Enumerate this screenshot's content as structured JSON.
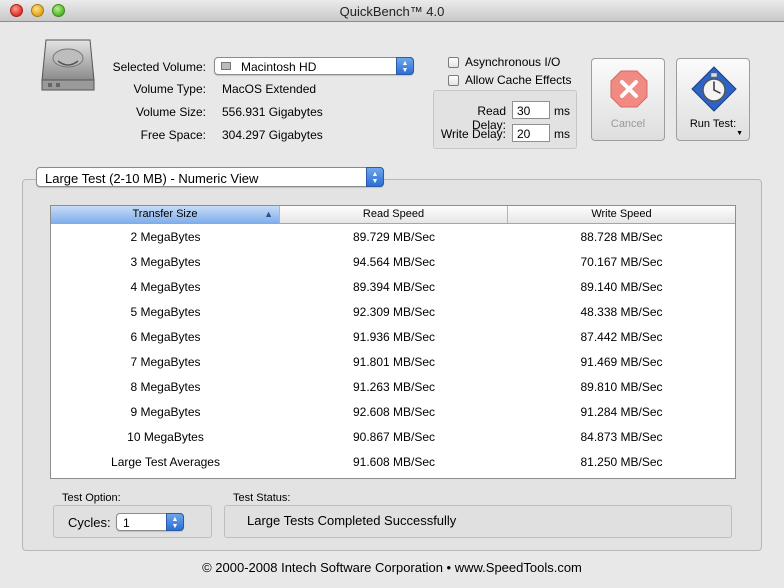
{
  "window": {
    "title": "QuickBench™ 4.0"
  },
  "volume_info": {
    "selected_volume_label": "Selected Volume:",
    "selected_volume_value": "Macintosh HD",
    "volume_type_label": "Volume Type:",
    "volume_type_value": "MacOS Extended",
    "volume_size_label": "Volume Size:",
    "volume_size_value": "556.931 Gigabytes",
    "free_space_label": "Free Space:",
    "free_space_value": "304.297 Gigabytes"
  },
  "options": {
    "async_io_label": "Asynchronous I/O",
    "async_io_checked": false,
    "allow_cache_label": "Allow Cache Effects",
    "allow_cache_checked": false,
    "read_delay_label": "Read Delay:",
    "read_delay_value": "30",
    "write_delay_label": "Write Delay:",
    "write_delay_value": "20",
    "delay_unit": "ms"
  },
  "buttons": {
    "cancel_label": "Cancel",
    "run_test_label": "Run Test:"
  },
  "view": {
    "selected": "Large Test (2-10 MB) - Numeric View"
  },
  "table": {
    "headers": [
      "Transfer Size",
      "Read Speed",
      "Write Speed"
    ],
    "rows": [
      [
        "2 MegaBytes",
        "89.729 MB/Sec",
        "88.728 MB/Sec"
      ],
      [
        "3 MegaBytes",
        "94.564 MB/Sec",
        "70.167 MB/Sec"
      ],
      [
        "4 MegaBytes",
        "89.394 MB/Sec",
        "89.140 MB/Sec"
      ],
      [
        "5 MegaBytes",
        "92.309 MB/Sec",
        "48.338 MB/Sec"
      ],
      [
        "6 MegaBytes",
        "91.936 MB/Sec",
        "87.442 MB/Sec"
      ],
      [
        "7 MegaBytes",
        "91.801 MB/Sec",
        "91.469 MB/Sec"
      ],
      [
        "8 MegaBytes",
        "91.263 MB/Sec",
        "89.810 MB/Sec"
      ],
      [
        "9 MegaBytes",
        "92.608 MB/Sec",
        "91.284 MB/Sec"
      ],
      [
        "10 MegaBytes",
        "90.867 MB/Sec",
        "84.873 MB/Sec"
      ],
      [
        "Large Test Averages",
        "91.608 MB/Sec",
        "81.250 MB/Sec"
      ]
    ]
  },
  "test_option": {
    "label": "Test Option:",
    "cycles_label": "Cycles:",
    "cycles_value": "1"
  },
  "test_status": {
    "label": "Test Status:",
    "message": "Large Tests Completed Successfully"
  },
  "footer": {
    "text": "© 2000-2008 Intech Software Corporation • www.SpeedTools.com"
  }
}
